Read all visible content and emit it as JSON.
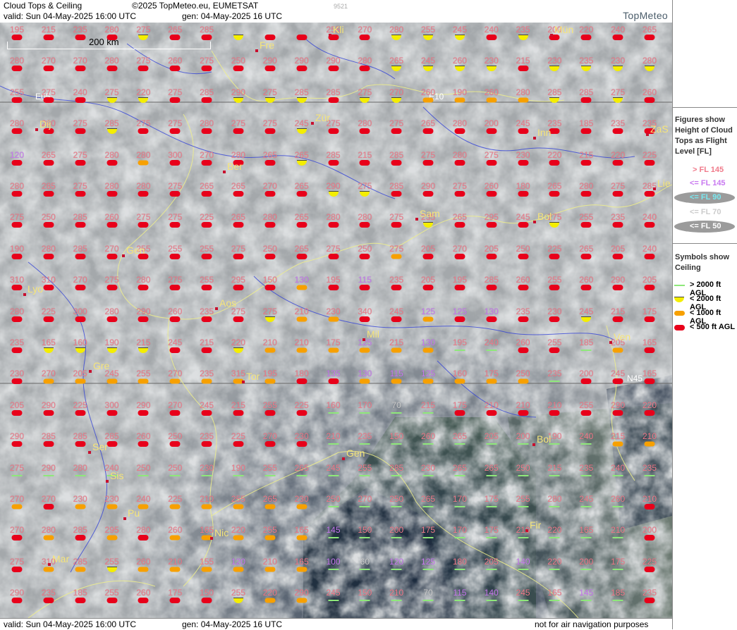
{
  "header": {
    "title": "Cloud Tops & Ceiling",
    "copyright": "©2025 TopMeteo.eu, EUMETSAT",
    "id": "9521",
    "valid": "valid:  Sun  04-May-2025  16:00 UTC",
    "gen": "gen: 04-May-2025 16 UTC",
    "logo": "TopMeteo"
  },
  "footer": {
    "valid": "valid:  Sun  04-May-2025  16:00 UTC",
    "gen": "gen: 04-May-2025 16 UTC",
    "notice": "not for air navigation purposes"
  },
  "map": {
    "scale_label": "200 km",
    "grid_labels": [
      "E05",
      "E10",
      "N45"
    ],
    "cities": [
      "Kli",
      "Mün",
      "Fre",
      "Zür",
      "Dij",
      "Inn",
      "ZaS",
      "Ber",
      "Lie",
      "Sam",
      "Bol",
      "Gen",
      "Lyo",
      "Aos",
      "Mil",
      "Ven",
      "Gre",
      "Tor",
      "Ser",
      "Gen",
      "Bol",
      "Sis",
      "Pu",
      "Nic",
      "Fir",
      "Mar"
    ]
  },
  "legend": {
    "tops_title": "Figures show Height of Cloud Tops as Flight Level  [FL]",
    "tops": [
      {
        "label": "> FL 145",
        "color": "#f07a8a"
      },
      {
        "label": "<= FL 145",
        "color": "#c878f0"
      },
      {
        "label": "<= FL 90",
        "color": "#78e8f0"
      },
      {
        "label": "<= FL 70",
        "color": "#cccccc"
      },
      {
        "label": "<= FL 50",
        "color": "#ffffff"
      }
    ],
    "ceiling_title": "Symbols show Ceiling",
    "ceiling": [
      {
        "label": "> 2000 ft AGL",
        "symbol": "green"
      },
      {
        "label": "< 2000 ft AGL",
        "symbol": "yellow"
      },
      {
        "label": "< 1000 ft AGL",
        "symbol": "orange"
      },
      {
        "label": "< 500 ft AGL",
        "symbol": "red"
      }
    ]
  },
  "grid": {
    "cols": 21,
    "rows": 19,
    "ceiling_codes": "R red, O orange, Y yellow, G green",
    "values": [
      [
        "195",
        "215",
        "235",
        "280",
        "275",
        "265",
        "285",
        "",
        "",
        "",
        "255",
        "270",
        "280",
        "255",
        "245",
        "240",
        "235",
        "200",
        "220",
        "240",
        "265"
      ],
      [
        "280",
        "270",
        "270",
        "280",
        "275",
        "260",
        "275",
        "250",
        "290",
        "290",
        "290",
        "280",
        "265",
        "245",
        "260",
        "230",
        "215",
        "230",
        "235",
        "230",
        "280"
      ],
      [
        "255",
        "275",
        "240",
        "275",
        "220",
        "275",
        "285",
        "290",
        "275",
        "285",
        "285",
        "275",
        "270",
        "260",
        "190",
        "260",
        "280",
        "285",
        "285",
        "275",
        "260"
      ],
      [
        "280",
        "280",
        "275",
        "285",
        "275",
        "275",
        "280",
        "275",
        "275",
        "245",
        "275",
        "280",
        "275",
        "265",
        "280",
        "200",
        "245",
        "235",
        "185",
        "235",
        "235"
      ],
      [
        "120",
        "265",
        "275",
        "280",
        "280",
        "300",
        "270",
        "280",
        "265",
        "265",
        "285",
        "215",
        "285",
        "275",
        "280",
        "275",
        "230",
        "220",
        "215",
        "220",
        "225"
      ],
      [
        "280",
        "285",
        "275",
        "280",
        "280",
        "275",
        "265",
        "265",
        "270",
        "265",
        "290",
        "275",
        "285",
        "290",
        "275",
        "260",
        "180",
        "265",
        "280",
        "275",
        "285"
      ],
      [
        "275",
        "250",
        "285",
        "260",
        "275",
        "275",
        "225",
        "265",
        "280",
        "265",
        "280",
        "280",
        "275",
        "235",
        "265",
        "295",
        "245",
        "275",
        "255",
        "235",
        "240"
      ],
      [
        "190",
        "280",
        "285",
        "270",
        "255",
        "255",
        "255",
        "275",
        "250",
        "265",
        "275",
        "250",
        "275",
        "205",
        "270",
        "205",
        "250",
        "225",
        "265",
        "205",
        "240"
      ],
      [
        "310",
        "310",
        "270",
        "275",
        "280",
        "275",
        "255",
        "295",
        "150",
        "130",
        "195",
        "115",
        "235",
        "205",
        "195",
        "285",
        "260",
        "255",
        "260",
        "290",
        "205"
      ],
      [
        "280",
        "225",
        "300",
        "280",
        "290",
        "260",
        "235",
        "275",
        "275",
        "210",
        "230",
        "340",
        "245",
        "125",
        "125",
        "130",
        "235",
        "230",
        "245",
        "215",
        "175"
      ],
      [
        "235",
        "165",
        "160",
        "190",
        "215",
        "245",
        "215",
        "220",
        "210",
        "210",
        "175",
        "125",
        "215",
        "130",
        "195",
        "240",
        "260",
        "255",
        "185",
        "205",
        "165"
      ],
      [
        "230",
        "270",
        "205",
        "245",
        "255",
        "270",
        "235",
        "315",
        "195",
        "180",
        "135",
        "130",
        "115",
        "125",
        "160",
        "175",
        "250",
        "235",
        "200",
        "245",
        "165"
      ],
      [
        "205",
        "290",
        "225",
        "300",
        "290",
        "270",
        "245",
        "215",
        "255",
        "225",
        "160",
        "170",
        "70",
        "215",
        "175",
        "210",
        "210",
        "210",
        "255",
        "290",
        "220"
      ],
      [
        "290",
        "285",
        "285",
        "285",
        "260",
        "250",
        "235",
        "225",
        "270",
        "230",
        "210",
        "235",
        "150",
        "260",
        "265",
        "205",
        "200",
        "190",
        "240",
        "215",
        "210"
      ],
      [
        "275",
        "290",
        "280",
        "240",
        "250",
        "250",
        "230",
        "190",
        "255",
        "265",
        "245",
        "255",
        "285",
        "230",
        "265",
        "265",
        "250",
        "215",
        "235",
        "240",
        "235"
      ],
      [
        "270",
        "270",
        "230",
        "230",
        "240",
        "225",
        "210",
        "255",
        "265",
        "230",
        "250",
        "270",
        "250",
        "265",
        "170",
        "175",
        "255",
        "280",
        "245",
        "260",
        "210"
      ],
      [
        "270",
        "280",
        "285",
        "295",
        "280",
        "260",
        "165",
        "220",
        "255",
        "165",
        "145",
        "150",
        "200",
        "175",
        "170",
        "175",
        "210",
        "220",
        "165",
        "210",
        "200"
      ],
      [
        "275",
        "310",
        "285",
        "255",
        "260",
        "210",
        "155",
        "120",
        "210",
        "165",
        "100",
        "60",
        "120",
        "125",
        "180",
        "205",
        "140",
        "220",
        "200",
        "175",
        "225"
      ],
      [
        "290",
        "235",
        "185",
        "255",
        "260",
        "175",
        "150",
        "255",
        "220",
        "290",
        "245",
        "150",
        "210",
        "70",
        "115",
        "140",
        "245",
        "165",
        "145",
        "185",
        "235"
      ]
    ],
    "ceiling": [
      "RRRRYRRYRRRRYYYRYRRRR",
      "RRRRRRRRRRRRYYYYRYYYY",
      "RRRYYRRYYYRYYOOOOYRYR",
      "RRRYRRRRRYRRRRRRRRRRR",
      "RRRRORRRRYRRRRRRRRRRR",
      "RRRRRRRRRRYYRRRRRRRRR",
      "RRRRRRRRRRRRRYRRRYRRR",
      "RRRRRRRRRRRRORRRRRRRR",
      "RRRRRRRRRORRRRRRRRRRR",
      "RRRRRRRRYOORRORRRRYRR",
      "RYYYYRRYOOOOOOGGRRGOR",
      "ROOOOOOOORROOOOOOGRRR",
      "RRRRRRRRRRGGGGRRRRRRR",
      "RRRRRRRRRRGGGGGGGGGOO",
      "GGGGGGGGGGGGGGGGGGGGG",
      "OROOOOOOOOGGGGGGGGGGR",
      "ROROROOOOOGGGGGGGGGGR",
      "ROOYOOOOOOGGGGGGGGGGR",
      "RRRRRRRYOOGGGGGGGGGGR"
    ]
  }
}
